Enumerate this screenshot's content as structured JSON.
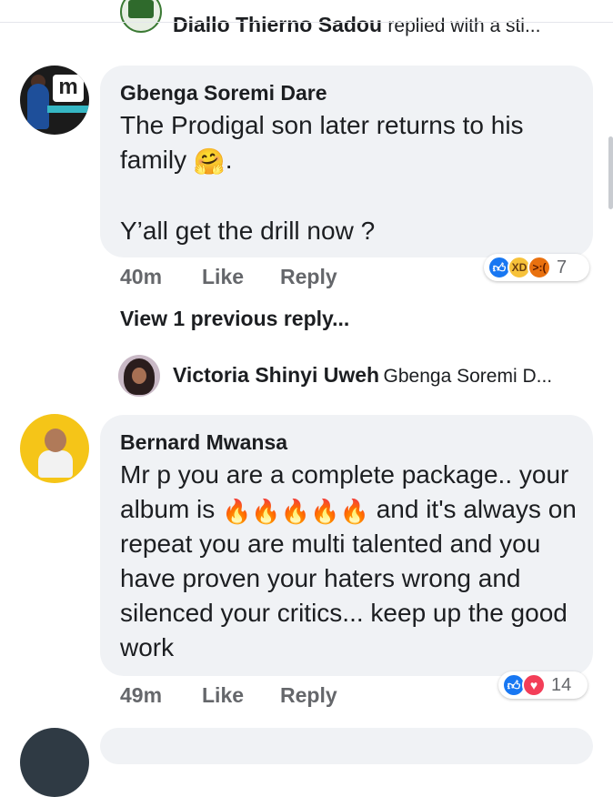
{
  "top_reply": {
    "name": "Diallo Thierno Sadou",
    "text": "replied with a sti..."
  },
  "comments": [
    {
      "author": "Gbenga Soremi Dare",
      "line1": "The Prodigal son later returns to his family ",
      "emoji": "🤗",
      "line1_end": ".",
      "line2": "Y’all get the drill now ?",
      "time": "40m",
      "like": "Like",
      "reply": "Reply",
      "reactions": {
        "icons": [
          "like-icon",
          "haha-icon",
          "angry-icon"
        ],
        "count": "7"
      }
    },
    {
      "author": "Bernard Mwansa",
      "text_start": "Mr p you are a complete package.. your album is ",
      "fire_icons": [
        "🔥",
        "🔥",
        "🔥",
        "🔥",
        "🔥"
      ],
      "text_end": " and it's always on repeat you are multi talented and you have proven your haters wrong and silenced your critics... keep up the good work",
      "time": "49m",
      "like": "Like",
      "reply": "Reply",
      "reactions": {
        "icons": [
          "like-icon",
          "love-icon"
        ],
        "count": "14"
      }
    }
  ],
  "view_previous": "View 1 previous reply...",
  "reply_preview": {
    "name": "Victoria Shinyi Uweh",
    "text": "Gbenga Soremi D..."
  },
  "colors": {
    "bubble": "#f0f2f5",
    "meta_text": "#65676b",
    "like_blue": "#1877f2",
    "love_red": "#f33e58"
  }
}
